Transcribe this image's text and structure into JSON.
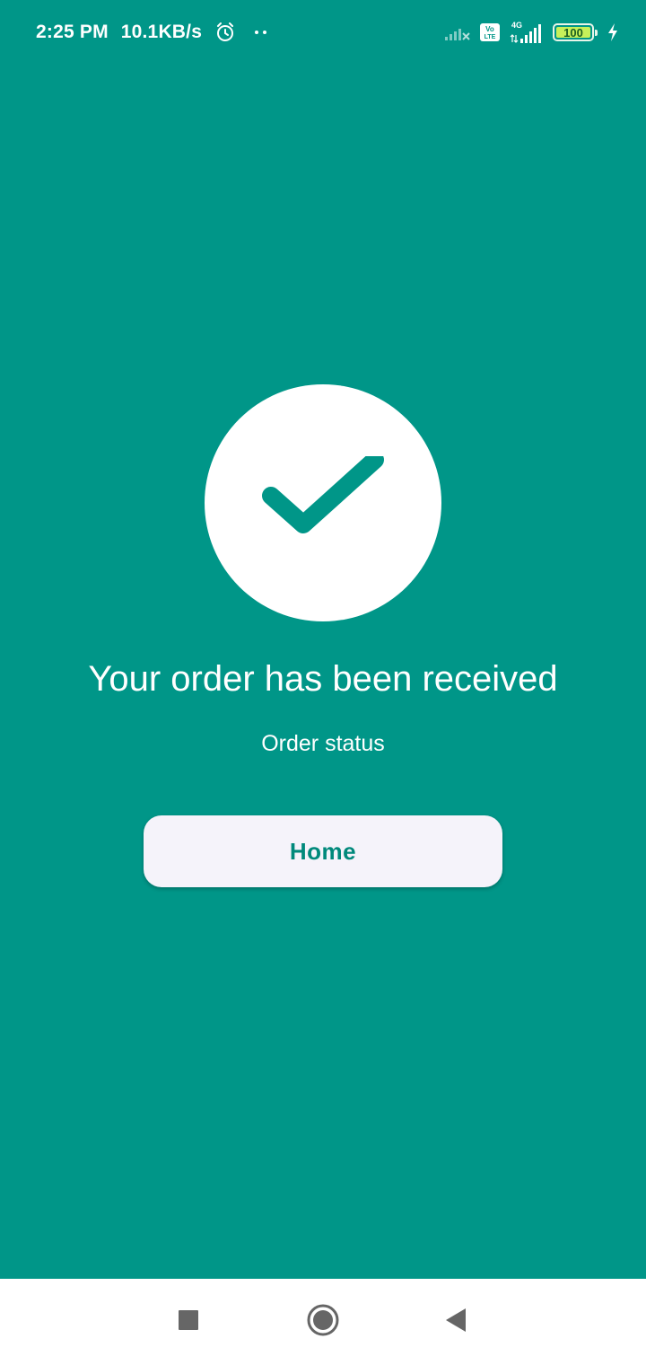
{
  "status_bar": {
    "time": "2:25 PM",
    "network_speed": "10.1KB/s",
    "battery_level": "100",
    "battery_fraction": 1.0,
    "network_type": "4G",
    "volte_top": "Vo",
    "volte_bottom": "LTE"
  },
  "main": {
    "title": "Your order has been received",
    "subtitle": "Order status",
    "home_button_label": "Home"
  },
  "colors": {
    "background": "#009688",
    "button_bg": "#f5f3fa",
    "button_text": "#00897b",
    "nav_icon": "#666666"
  },
  "icons": {
    "status": [
      "alarm-icon",
      "notification-dots-icon",
      "signal-weak-icon",
      "volte-icon",
      "signal-4g-icon",
      "battery-icon",
      "charging-icon"
    ],
    "center": "checkmark-icon",
    "nav": [
      "recent-apps-icon",
      "home-nav-icon",
      "back-icon"
    ]
  }
}
